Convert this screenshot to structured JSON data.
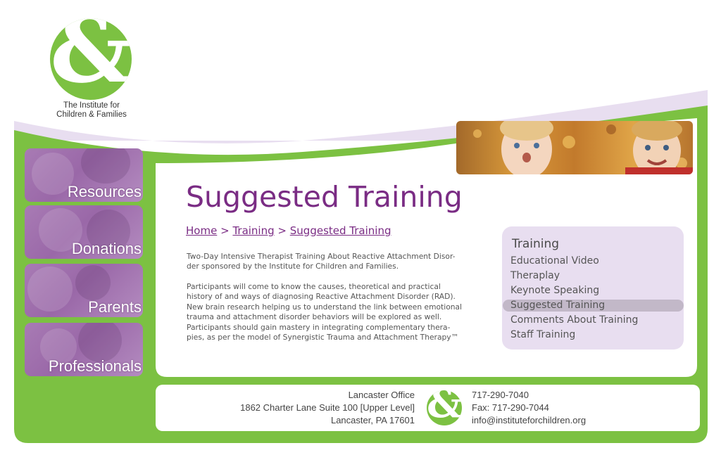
{
  "logo": {
    "symbol": "&",
    "line1": "The Institute for",
    "line2": "Children & Families"
  },
  "nav": [
    {
      "label": "Resources"
    },
    {
      "label": "Donations"
    },
    {
      "label": "Parents"
    },
    {
      "label": "Professionals"
    }
  ],
  "page": {
    "title": "Suggested Training",
    "breadcrumb": {
      "home": "Home",
      "sep1": ">",
      "training": "Training",
      "sep2": ">",
      "current": "Suggested Training"
    },
    "paragraph1": [
      "Two-Day Intensive Therapist Training About Reactive Attachment Disor-",
      "der sponsored by the Institute for Children and Families."
    ],
    "paragraph2": [
      "Participants will come to know the causes, theoretical and practical",
      "history of and ways of diagnosing Reactive Attachment Disorder (RAD).",
      "New brain research helping us to understand the link between emotional",
      "trauma and attachment disorder behaviors will be explored as well.",
      "Participants should gain mastery in integrating complementary thera-",
      "pies, as per the model of Synergistic Trauma and Attachment Therapy™"
    ]
  },
  "sidemenu": {
    "heading": "Training",
    "items": [
      {
        "label": "Educational Video"
      },
      {
        "label": "Theraplay"
      },
      {
        "label": "Keynote Speaking"
      },
      {
        "label": "Suggested Training"
      },
      {
        "label": "Comments About Training"
      },
      {
        "label": "Staff Training"
      }
    ],
    "active_index": 3
  },
  "footer": {
    "office": "Lancaster Office",
    "address1": "1862 Charter Lane Suite 100 [Upper Level]",
    "address2": "Lancaster, PA 17601",
    "phone": "717-290-7040",
    "fax": "Fax: 717-290-7044",
    "email": "info@instituteforchildren.org"
  },
  "colors": {
    "green": "#7cc142",
    "lavender": "#e8def0",
    "purple_text": "#7a2c84",
    "tile_purple": "#a87bb4"
  }
}
